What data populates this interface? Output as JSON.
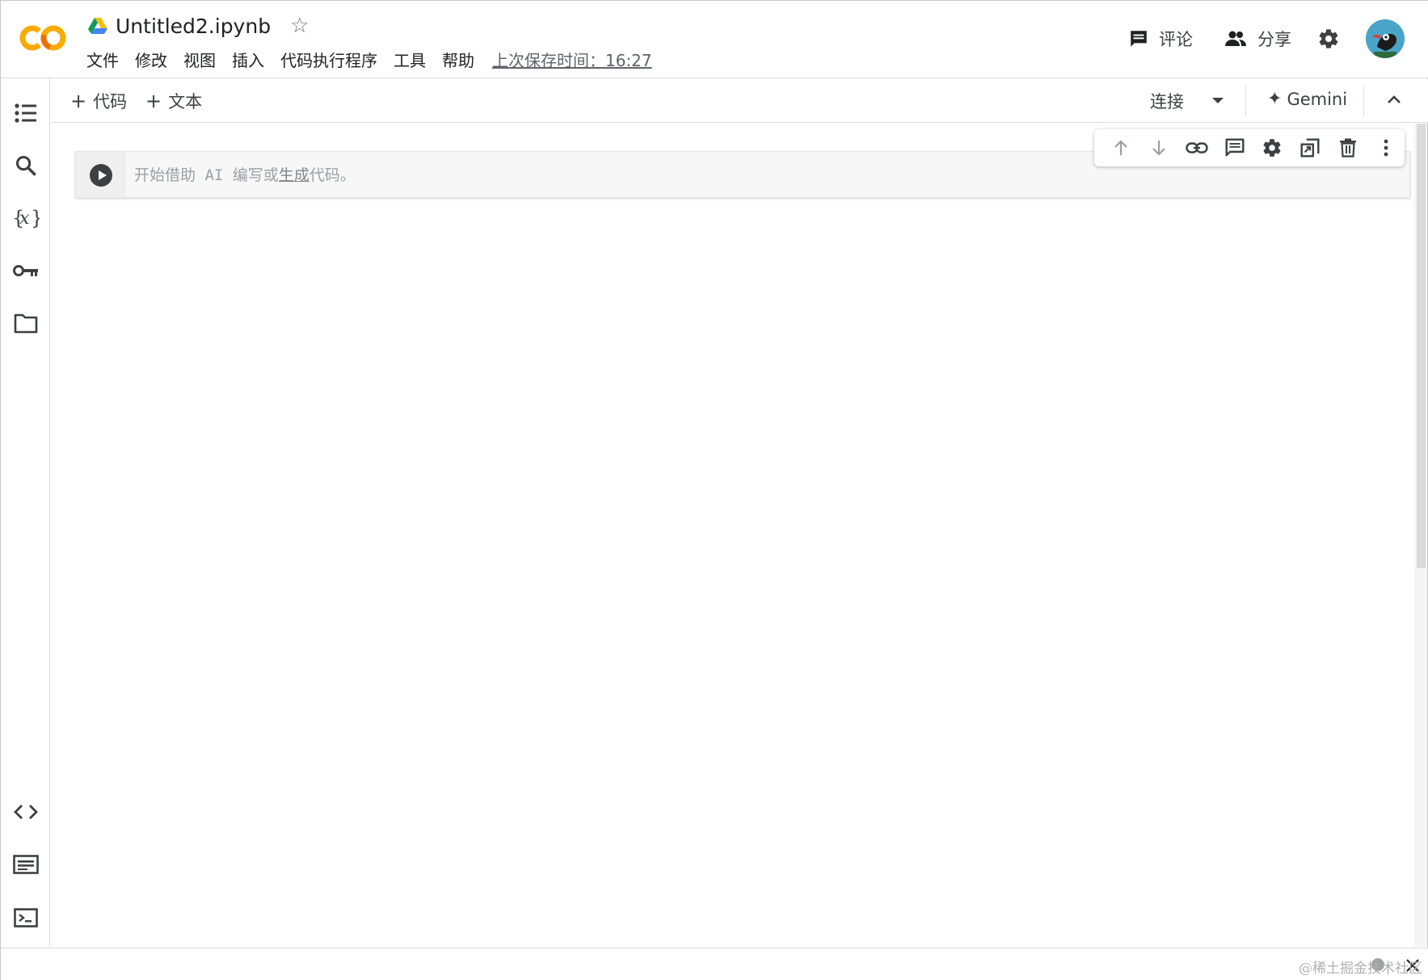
{
  "app": {
    "title": "Untitled2.ipynb",
    "save_status": "上次保存时间：16:27"
  },
  "menu": {
    "items": [
      "文件",
      "修改",
      "视图",
      "插入",
      "代码执行程序",
      "工具",
      "帮助"
    ]
  },
  "header": {
    "comment_label": "评论",
    "share_label": "分享"
  },
  "toolbar": {
    "add_code_label": "代码",
    "add_text_label": "文本",
    "connect_label": "连接",
    "gemini_label": "Gemini"
  },
  "cell": {
    "placeholder_prefix": "开始借助 AI 编写或",
    "placeholder_link": "生成",
    "placeholder_suffix": "代码。"
  },
  "footer": {
    "watermark": "@稀土掘金技术社区"
  },
  "colors": {
    "brand_orange": "#F9AB00",
    "brand_orange_dark": "#E8710A",
    "icon_gray": "#3c4043",
    "muted_gray": "#757575",
    "border": "#dadce0"
  },
  "icons": {
    "left_rail": [
      "table-of-contents-icon",
      "search-icon",
      "variables-icon",
      "secrets-key-icon",
      "files-folder-icon",
      "code-snippets-icon",
      "command-palette-icon",
      "terminal-icon"
    ],
    "cell_toolbar": [
      "move-up-icon",
      "move-down-icon",
      "link-icon",
      "comment-icon",
      "settings-icon",
      "mirror-cell-icon",
      "delete-icon",
      "more-vert-icon"
    ]
  }
}
